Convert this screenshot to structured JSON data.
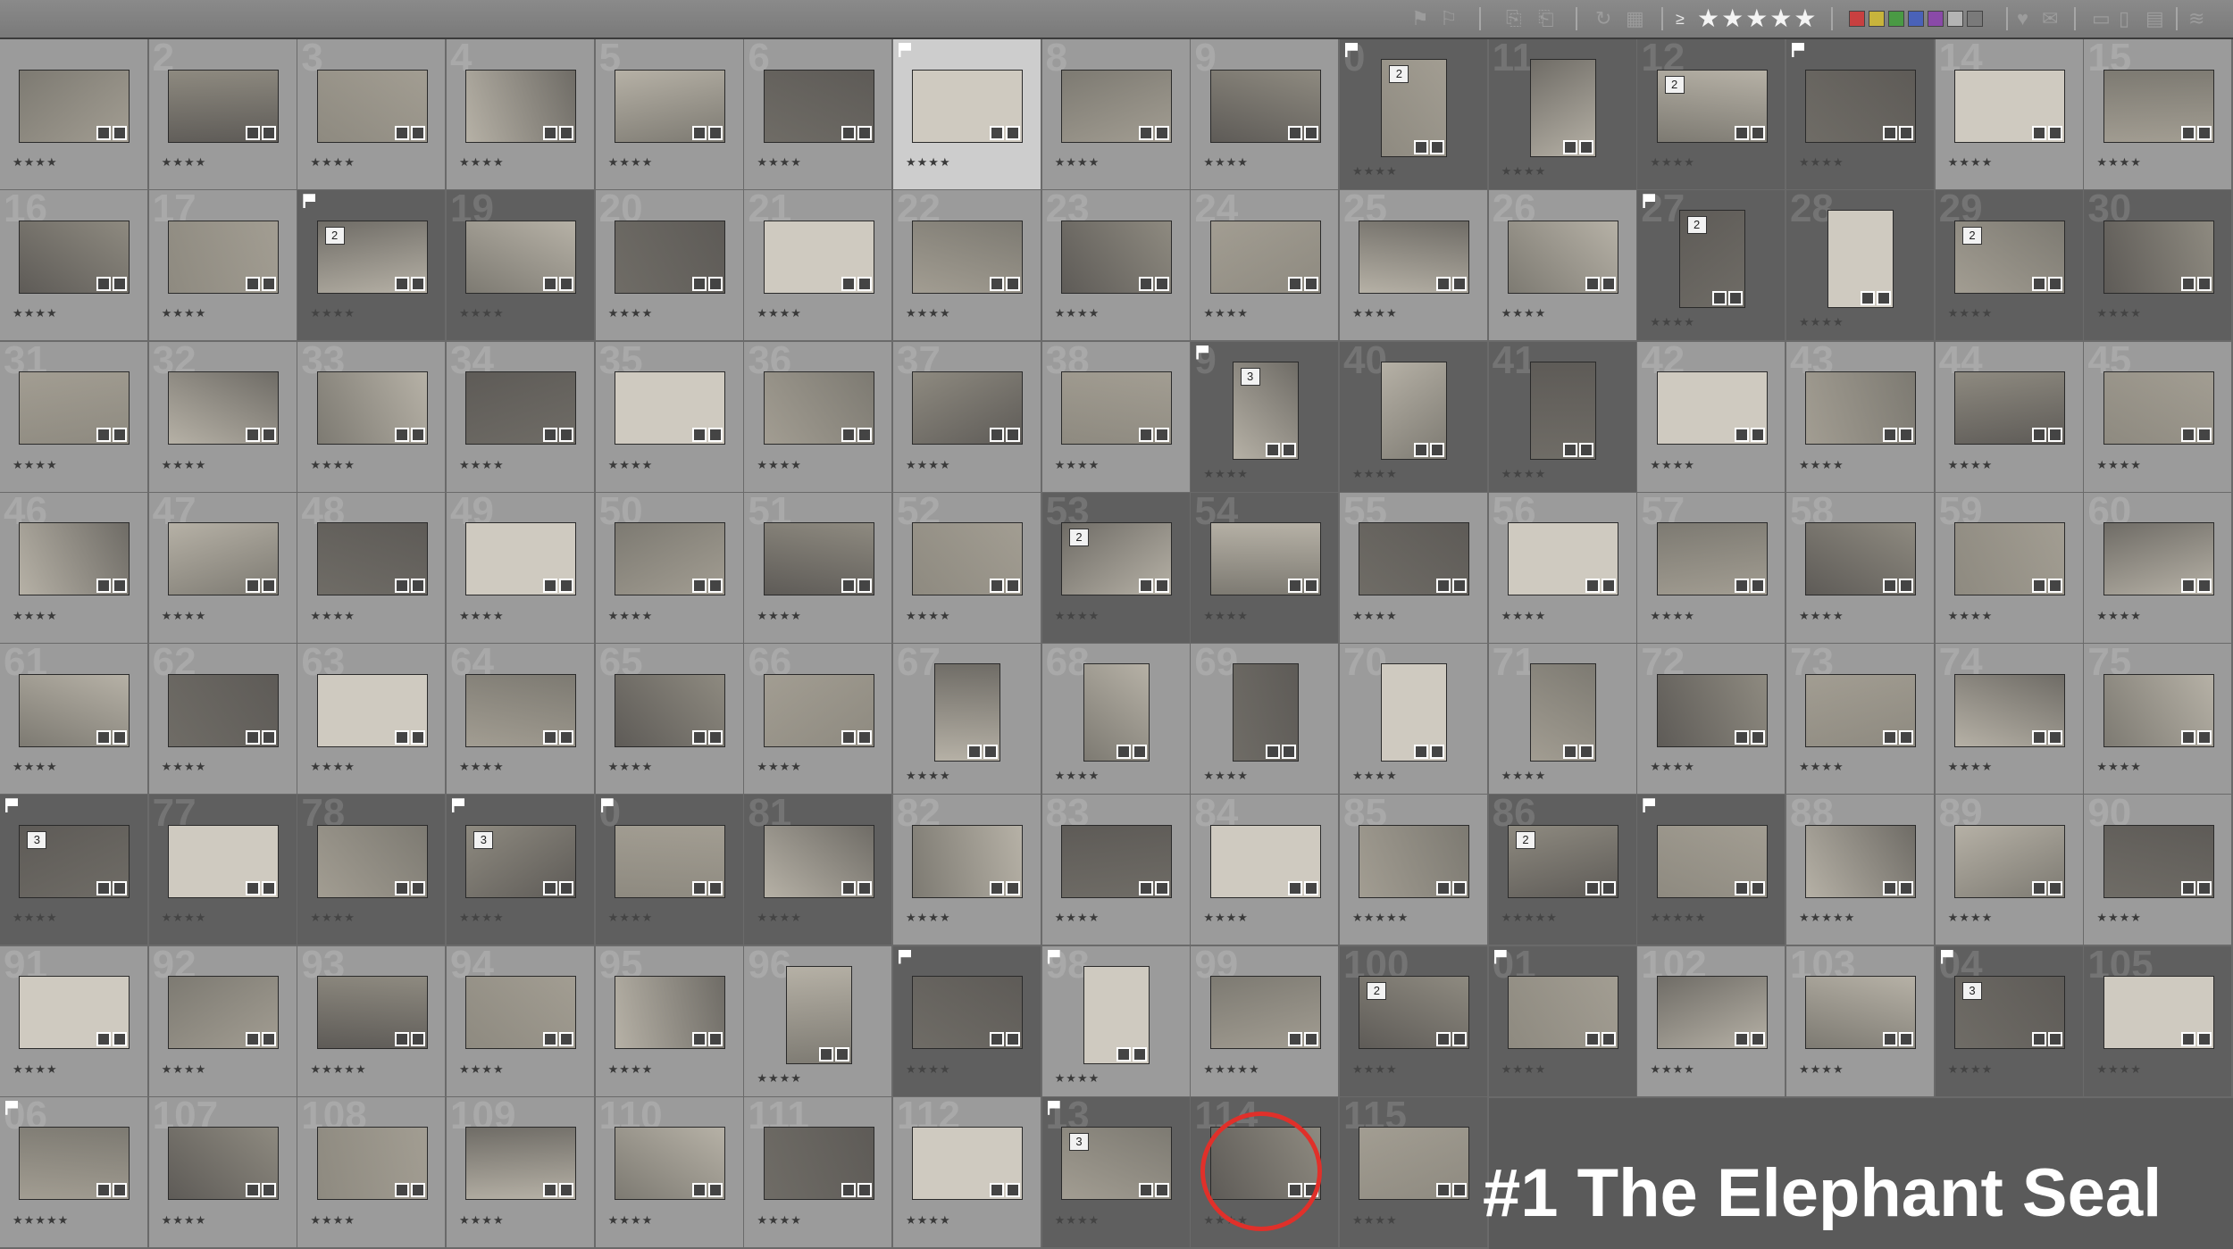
{
  "toolbar": {
    "rating_filter_label": "≥",
    "rating_filter_stars": "★★★★★",
    "label_colors": [
      "#c84040",
      "#c8b43c",
      "#4a9a44",
      "#4a62b8",
      "#8a4aa8",
      "#b4b4b4",
      "#7a7a7a"
    ],
    "icons": [
      "flag-icon",
      "flag-reject-icon",
      "copy-icon",
      "paste-icon",
      "rotate-icon",
      "grid-icon",
      "heart-icon",
      "comment-icon",
      "layout-icon",
      "stack-icon"
    ]
  },
  "columns": 15,
  "rows": 8,
  "cells": [
    {
      "n": "",
      "t": "gray",
      "r": "★★★★"
    },
    {
      "n": "2",
      "t": "gray",
      "r": "★★★★"
    },
    {
      "n": "3",
      "t": "gray",
      "r": "★★★★"
    },
    {
      "n": "4",
      "t": "gray",
      "r": "★★★★"
    },
    {
      "n": "5",
      "t": "gray",
      "r": "★★★★"
    },
    {
      "n": "6",
      "t": "gray",
      "r": "★★★★"
    },
    {
      "n": "",
      "t": "sel",
      "r": "★★★★",
      "flag": true
    },
    {
      "n": "8",
      "t": "gray",
      "r": "★★★★"
    },
    {
      "n": "9",
      "t": "gray",
      "r": "★★★★"
    },
    {
      "n": "0",
      "t": "dark",
      "r": "★★★★",
      "flag": true,
      "stack": "2",
      "p": true
    },
    {
      "n": "11",
      "t": "dark",
      "r": "★★★★",
      "p": true
    },
    {
      "n": "12",
      "t": "dark",
      "r": "★★★★",
      "stack": "2"
    },
    {
      "n": "",
      "t": "dark",
      "r": "★★★★",
      "flag": true
    },
    {
      "n": "14",
      "t": "gray",
      "r": "★★★★"
    },
    {
      "n": "15",
      "t": "gray",
      "r": "★★★★"
    },
    {
      "n": "16",
      "t": "gray",
      "r": "★★★★"
    },
    {
      "n": "17",
      "t": "gray",
      "r": "★★★★"
    },
    {
      "n": "",
      "t": "dark",
      "r": "★★★★",
      "flag": true,
      "stack": "2"
    },
    {
      "n": "19",
      "t": "dark",
      "r": "★★★★"
    },
    {
      "n": "20",
      "t": "gray",
      "r": "★★★★"
    },
    {
      "n": "21",
      "t": "gray",
      "r": "★★★★"
    },
    {
      "n": "22",
      "t": "gray",
      "r": "★★★★"
    },
    {
      "n": "23",
      "t": "gray",
      "r": "★★★★"
    },
    {
      "n": "24",
      "t": "gray",
      "r": "★★★★"
    },
    {
      "n": "25",
      "t": "gray",
      "r": "★★★★"
    },
    {
      "n": "26",
      "t": "gray",
      "r": "★★★★"
    },
    {
      "n": "27",
      "t": "dark",
      "r": "★★★★",
      "flag": true,
      "stack": "2",
      "p": true
    },
    {
      "n": "28",
      "t": "dark",
      "r": "★★★★",
      "p": true
    },
    {
      "n": "29",
      "t": "dark",
      "r": "★★★★",
      "stack": "2"
    },
    {
      "n": "30",
      "t": "dark",
      "r": "★★★★"
    },
    {
      "n": "31",
      "t": "gray",
      "r": "★★★★"
    },
    {
      "n": "32",
      "t": "gray",
      "r": "★★★★"
    },
    {
      "n": "33",
      "t": "gray",
      "r": "★★★★"
    },
    {
      "n": "34",
      "t": "gray",
      "r": "★★★★"
    },
    {
      "n": "35",
      "t": "gray",
      "r": "★★★★"
    },
    {
      "n": "36",
      "t": "gray",
      "r": "★★★★"
    },
    {
      "n": "37",
      "t": "gray",
      "r": "★★★★"
    },
    {
      "n": "38",
      "t": "gray",
      "r": "★★★★"
    },
    {
      "n": "9",
      "t": "dark",
      "r": "★★★★",
      "flag": true,
      "stack": "3",
      "p": true
    },
    {
      "n": "40",
      "t": "dark",
      "r": "★★★★",
      "p": true
    },
    {
      "n": "41",
      "t": "dark",
      "r": "★★★★",
      "p": true
    },
    {
      "n": "42",
      "t": "gray",
      "r": "★★★★"
    },
    {
      "n": "43",
      "t": "gray",
      "r": "★★★★"
    },
    {
      "n": "44",
      "t": "gray",
      "r": "★★★★"
    },
    {
      "n": "45",
      "t": "gray",
      "r": "★★★★"
    },
    {
      "n": "46",
      "t": "gray",
      "r": "★★★★"
    },
    {
      "n": "47",
      "t": "gray",
      "r": "★★★★"
    },
    {
      "n": "48",
      "t": "gray",
      "r": "★★★★"
    },
    {
      "n": "49",
      "t": "gray",
      "r": "★★★★"
    },
    {
      "n": "50",
      "t": "gray",
      "r": "★★★★"
    },
    {
      "n": "51",
      "t": "gray",
      "r": "★★★★"
    },
    {
      "n": "52",
      "t": "gray",
      "r": "★★★★"
    },
    {
      "n": "53",
      "t": "dark",
      "r": "★★★★",
      "stack": "2"
    },
    {
      "n": "54",
      "t": "dark",
      "r": "★★★★"
    },
    {
      "n": "55",
      "t": "gray",
      "r": "★★★★"
    },
    {
      "n": "56",
      "t": "gray",
      "r": "★★★★"
    },
    {
      "n": "57",
      "t": "gray",
      "r": "★★★★"
    },
    {
      "n": "58",
      "t": "gray",
      "r": "★★★★"
    },
    {
      "n": "59",
      "t": "gray",
      "r": "★★★★"
    },
    {
      "n": "60",
      "t": "gray",
      "r": "★★★★"
    },
    {
      "n": "61",
      "t": "gray",
      "r": "★★★★"
    },
    {
      "n": "62",
      "t": "gray",
      "r": "★★★★"
    },
    {
      "n": "63",
      "t": "gray",
      "r": "★★★★"
    },
    {
      "n": "64",
      "t": "gray",
      "r": "★★★★"
    },
    {
      "n": "65",
      "t": "gray",
      "r": "★★★★"
    },
    {
      "n": "66",
      "t": "gray",
      "r": "★★★★"
    },
    {
      "n": "67",
      "t": "gray",
      "r": "★★★★",
      "p": true
    },
    {
      "n": "68",
      "t": "gray",
      "r": "★★★★",
      "p": true
    },
    {
      "n": "69",
      "t": "gray",
      "r": "★★★★",
      "p": true
    },
    {
      "n": "70",
      "t": "gray",
      "r": "★★★★",
      "p": true
    },
    {
      "n": "71",
      "t": "gray",
      "r": "★★★★",
      "p": true
    },
    {
      "n": "72",
      "t": "gray",
      "r": "★★★★"
    },
    {
      "n": "73",
      "t": "gray",
      "r": "★★★★"
    },
    {
      "n": "74",
      "t": "gray",
      "r": "★★★★"
    },
    {
      "n": "75",
      "t": "gray",
      "r": "★★★★"
    },
    {
      "n": "",
      "t": "dark",
      "r": "★★★★",
      "flag": true,
      "stack": "3"
    },
    {
      "n": "77",
      "t": "dark",
      "r": "★★★★"
    },
    {
      "n": "78",
      "t": "dark",
      "r": "★★★★"
    },
    {
      "n": "",
      "t": "dark",
      "r": "★★★★",
      "flag": true,
      "stack": "3"
    },
    {
      "n": "0",
      "t": "dark",
      "r": "★★★★",
      "flag": true
    },
    {
      "n": "81",
      "t": "dark",
      "r": "★★★★"
    },
    {
      "n": "82",
      "t": "gray",
      "r": "★★★★"
    },
    {
      "n": "83",
      "t": "gray",
      "r": "★★★★"
    },
    {
      "n": "84",
      "t": "gray",
      "r": "★★★★"
    },
    {
      "n": "85",
      "t": "gray",
      "r": "★★★★★"
    },
    {
      "n": "86",
      "t": "dark",
      "r": "★★★★★",
      "stack": "2"
    },
    {
      "n": "",
      "t": "dark",
      "r": "★★★★★",
      "flag": true
    },
    {
      "n": "88",
      "t": "gray",
      "r": "★★★★★"
    },
    {
      "n": "89",
      "t": "gray",
      "r": "★★★★"
    },
    {
      "n": "90",
      "t": "gray",
      "r": "★★★★"
    },
    {
      "n": "91",
      "t": "gray",
      "r": "★★★★"
    },
    {
      "n": "92",
      "t": "gray",
      "r": "★★★★"
    },
    {
      "n": "93",
      "t": "gray",
      "r": "★★★★★"
    },
    {
      "n": "94",
      "t": "gray",
      "r": "★★★★"
    },
    {
      "n": "95",
      "t": "gray",
      "r": "★★★★"
    },
    {
      "n": "96",
      "t": "gray",
      "r": "★★★★",
      "p": true
    },
    {
      "n": "",
      "t": "dark",
      "r": "★★★★",
      "flag": true
    },
    {
      "n": "98",
      "t": "gray",
      "r": "★★★★",
      "flag": true,
      "p": true
    },
    {
      "n": "99",
      "t": "gray",
      "r": "★★★★★"
    },
    {
      "n": "100",
      "t": "dark",
      "r": "★★★★",
      "stack": "2"
    },
    {
      "n": "01",
      "t": "dark",
      "r": "★★★★",
      "flag": true
    },
    {
      "n": "102",
      "t": "gray",
      "r": "★★★★"
    },
    {
      "n": "103",
      "t": "gray",
      "r": "★★★★"
    },
    {
      "n": "04",
      "t": "dark",
      "r": "★★★★",
      "flag": true,
      "stack": "3"
    },
    {
      "n": "105",
      "t": "dark",
      "r": "★★★★"
    },
    {
      "n": "06",
      "t": "gray",
      "r": "★★★★★",
      "flag": true
    },
    {
      "n": "107",
      "t": "gray",
      "r": "★★★★"
    },
    {
      "n": "108",
      "t": "gray",
      "r": "★★★★"
    },
    {
      "n": "109",
      "t": "gray",
      "r": "★★★★"
    },
    {
      "n": "110",
      "t": "gray",
      "r": "★★★★"
    },
    {
      "n": "111",
      "t": "gray",
      "r": "★★★★"
    },
    {
      "n": "112",
      "t": "gray",
      "r": "★★★★"
    },
    {
      "n": "13",
      "t": "dark",
      "r": "★★★★",
      "flag": true,
      "stack": "3"
    },
    {
      "n": "114",
      "t": "dark",
      "r": "★★★★"
    },
    {
      "n": "115",
      "t": "dark",
      "r": "★★★★"
    }
  ],
  "caption": "#1 The Elephant Seal",
  "highlight_color": "#e0302a"
}
